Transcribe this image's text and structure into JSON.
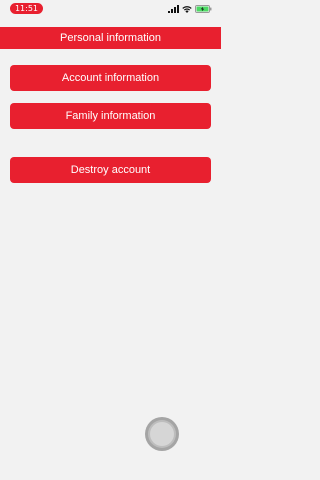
{
  "status_bar": {
    "time": "11:51",
    "signal_icon": "cellular-signal-icon",
    "wifi_icon": "wifi-icon",
    "battery_icon": "battery-charging-icon"
  },
  "header": {
    "title": "Personal information"
  },
  "menu": {
    "account_label": "Account information",
    "family_label": "Family information",
    "destroy_label": "Destroy account"
  },
  "colors": {
    "accent": "#e8202f",
    "background": "#f2f2f2",
    "battery": "#4cd964"
  },
  "overlay": {
    "assistive_touch_icon": "assistive-touch-icon"
  }
}
